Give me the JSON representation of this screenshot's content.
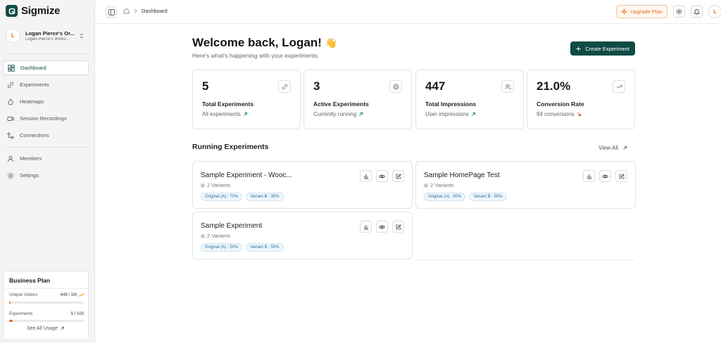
{
  "brand": {
    "name": "Sigmize",
    "accent": "#0f4c45",
    "highlight": "#e86a10"
  },
  "org": {
    "initial": "L",
    "name": "Logan Pierce's Or...",
    "workspace": "Logan Pierce's Works..."
  },
  "sidebar": {
    "items": [
      {
        "label": "Dashboard",
        "icon": "dashboard-icon"
      },
      {
        "label": "Experiments",
        "icon": "experiments-icon"
      },
      {
        "label": "Heatmaps",
        "icon": "heatmaps-icon"
      },
      {
        "label": "Session Recordings",
        "icon": "recording-icon"
      },
      {
        "label": "Connections",
        "icon": "connections-icon"
      },
      {
        "label": "Members",
        "icon": "members-icon"
      },
      {
        "label": "Settings",
        "icon": "settings-icon"
      }
    ],
    "active": "Dashboard"
  },
  "plan": {
    "title": "Business Plan",
    "visitors_label": "Unique Visitors",
    "visitors_value": "448 / 1M",
    "visitors_fraction": 0.000448,
    "experiments_label": "Experiments",
    "experiments_value": "5 / 100",
    "experiments_fraction": 0.05,
    "see_all": "See All Usage"
  },
  "topbar": {
    "breadcrumb": "Dashboard",
    "upgrade_label": "Upgrade Plan",
    "avatar_initial": "L"
  },
  "header": {
    "welcome": "Welcome back, Logan!",
    "wave": "👋",
    "subtitle": "Here's what's happening with your experiments.",
    "create_label": "Create Experiment"
  },
  "stats": [
    {
      "value": "5",
      "label": "Total Experiments",
      "sub": "All experiments",
      "icon": "link-icon",
      "trend": "up"
    },
    {
      "value": "3",
      "label": "Active Experiments",
      "sub": "Currently running",
      "icon": "target-icon",
      "trend": "up"
    },
    {
      "value": "447",
      "label": "Total Impressions",
      "sub": "User impressions",
      "icon": "users-icon",
      "trend": "up"
    },
    {
      "value": "21.0%",
      "label": "Conversion Rate",
      "sub": "94 conversions",
      "icon": "trending-icon",
      "trend": "down"
    }
  ],
  "running": {
    "title": "Running Experiments",
    "view_all": "View All",
    "experiments": [
      {
        "name": "Sample Experiment - Wooc...",
        "variants": "2 Variants",
        "pill_a": "Original (A) : 70%",
        "pill_b": "Variant B : 30%"
      },
      {
        "name": "Sample HomePage Test",
        "variants": "2 Variants",
        "pill_a": "Original (A) : 50%",
        "pill_b": "Variant B : 50%"
      },
      {
        "name": "Sample Experiment",
        "variants": "2 Variants",
        "pill_a": "Original (A) : 50%",
        "pill_b": "Variant B : 50%"
      }
    ]
  }
}
